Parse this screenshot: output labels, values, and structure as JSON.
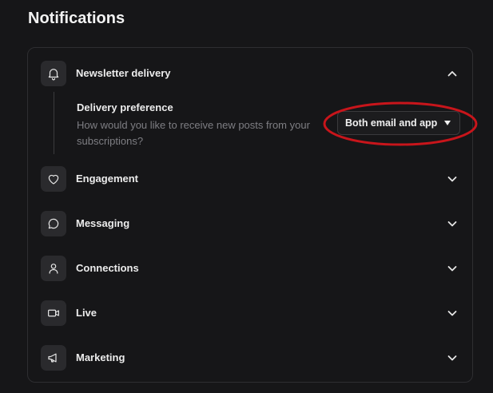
{
  "page": {
    "title": "Notifications"
  },
  "sections": [
    {
      "id": "newsletter",
      "label": "Newsletter delivery",
      "icon": "bell-icon",
      "expanded": true
    },
    {
      "id": "engagement",
      "label": "Engagement",
      "icon": "heart-icon",
      "expanded": false
    },
    {
      "id": "messaging",
      "label": "Messaging",
      "icon": "chat-bubble-icon",
      "expanded": false
    },
    {
      "id": "connections",
      "label": "Connections",
      "icon": "person-icon",
      "expanded": false
    },
    {
      "id": "live",
      "label": "Live",
      "icon": "video-camera-icon",
      "expanded": false
    },
    {
      "id": "marketing",
      "label": "Marketing",
      "icon": "megaphone-icon",
      "expanded": false
    }
  ],
  "delivery_preference": {
    "title": "Delivery preference",
    "description": "How would you like to receive new posts from your subscriptions?",
    "selected": "Both email and app"
  },
  "colors": {
    "background": "#161618",
    "panel_border": "#2e2e31",
    "icon_box": "#2a2a2d",
    "muted_text": "#7e7e83",
    "highlight_annotation": "#c8151b"
  }
}
